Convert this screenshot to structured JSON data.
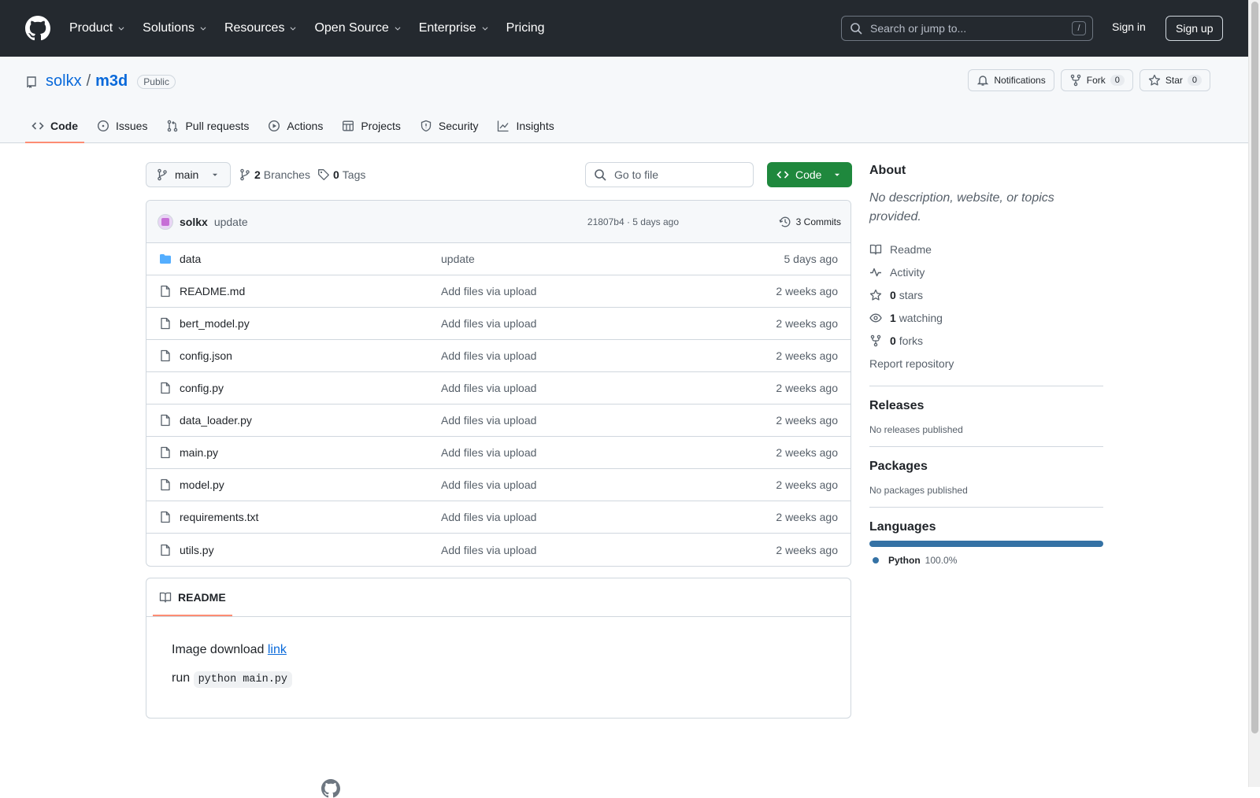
{
  "header": {
    "nav": [
      {
        "label": "Product",
        "has_menu": true
      },
      {
        "label": "Solutions",
        "has_menu": true
      },
      {
        "label": "Resources",
        "has_menu": true
      },
      {
        "label": "Open Source",
        "has_menu": true
      },
      {
        "label": "Enterprise",
        "has_menu": true
      },
      {
        "label": "Pricing",
        "has_menu": false
      }
    ],
    "search_placeholder": "Search or jump to...",
    "search_key": "/",
    "signin": "Sign in",
    "signup": "Sign up"
  },
  "repo": {
    "owner": "solkx",
    "separator": "/",
    "name": "m3d",
    "visibility": "Public",
    "notifications": "Notifications",
    "fork_label": "Fork",
    "fork_count": "0",
    "star_label": "Star",
    "star_count": "0",
    "tabs": [
      {
        "label": "Code",
        "icon": "code-icon",
        "active": true
      },
      {
        "label": "Issues",
        "icon": "issue-icon",
        "active": false
      },
      {
        "label": "Pull requests",
        "icon": "pull-request-icon",
        "active": false
      },
      {
        "label": "Actions",
        "icon": "play-icon",
        "active": false
      },
      {
        "label": "Projects",
        "icon": "table-icon",
        "active": false
      },
      {
        "label": "Security",
        "icon": "shield-icon",
        "active": false
      },
      {
        "label": "Insights",
        "icon": "graph-icon",
        "active": false
      }
    ]
  },
  "branch": {
    "name": "main",
    "branches_count": "2",
    "branches_label": "Branches",
    "tags_count": "0",
    "tags_label": "Tags",
    "goto_placeholder": "Go to file",
    "code_button": "Code"
  },
  "commit": {
    "author": "solkx",
    "message": "update",
    "meta": "21807b4 · 5 days ago",
    "commits_label": "3 Commits"
  },
  "files": [
    {
      "name": "data",
      "type": "dir",
      "commit": "update",
      "age": "5 days ago"
    },
    {
      "name": "README.md",
      "type": "file",
      "commit": "Add files via upload",
      "age": "2 weeks ago"
    },
    {
      "name": "bert_model.py",
      "type": "file",
      "commit": "Add files via upload",
      "age": "2 weeks ago"
    },
    {
      "name": "config.json",
      "type": "file",
      "commit": "Add files via upload",
      "age": "2 weeks ago"
    },
    {
      "name": "config.py",
      "type": "file",
      "commit": "Add files via upload",
      "age": "2 weeks ago"
    },
    {
      "name": "data_loader.py",
      "type": "file",
      "commit": "Add files via upload",
      "age": "2 weeks ago"
    },
    {
      "name": "main.py",
      "type": "file",
      "commit": "Add files via upload",
      "age": "2 weeks ago"
    },
    {
      "name": "model.py",
      "type": "file",
      "commit": "Add files via upload",
      "age": "2 weeks ago"
    },
    {
      "name": "requirements.txt",
      "type": "file",
      "commit": "Add files via upload",
      "age": "2 weeks ago"
    },
    {
      "name": "utils.py",
      "type": "file",
      "commit": "Add files via upload",
      "age": "2 weeks ago"
    }
  ],
  "readme": {
    "tab_label": "README",
    "line1_text": "Image download ",
    "line1_link": "link",
    "line2_text": "run ",
    "line2_code": "python main.py"
  },
  "about": {
    "heading": "About",
    "description": "No description, website, or topics provided.",
    "items": [
      {
        "icon": "book-icon",
        "count": "",
        "label": "Readme"
      },
      {
        "icon": "pulse-icon",
        "count": "",
        "label": "Activity"
      },
      {
        "icon": "star-icon",
        "count": "0",
        "label": "stars"
      },
      {
        "icon": "eye-icon",
        "count": "1",
        "label": "watching"
      },
      {
        "icon": "fork-icon",
        "count": "0",
        "label": "forks"
      }
    ],
    "report": "Report repository"
  },
  "releases": {
    "heading": "Releases",
    "text": "No releases published"
  },
  "packages": {
    "heading": "Packages",
    "text": "No packages published"
  },
  "languages": {
    "heading": "Languages",
    "name": "Python",
    "percent": "100.0%",
    "color": "#3572a5"
  },
  "colors": {
    "header_bg": "#24292f",
    "accent": "#0969da",
    "code_button": "#1f883d",
    "tab_underline": "#fd8c73"
  }
}
